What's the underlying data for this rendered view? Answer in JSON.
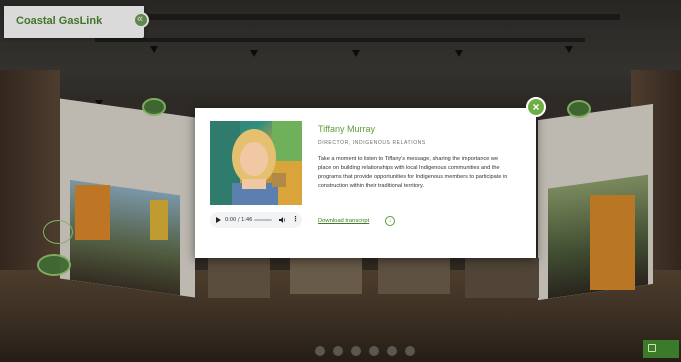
{
  "brand": {
    "name": "Coastal GasLink"
  },
  "modal": {
    "name": "Tiffany Murray",
    "role": "DIRECTOR, INDIGENOUS RELATIONS",
    "description": "Take a moment to listen to Tiffany's message, sharing the importance we place on building relationships with local Indigenous communities and the programs that provide opportunities for Indigenous members to participate in construction within their traditional territory.",
    "download_label": "Download transcript",
    "close_symbol": "×",
    "audio": {
      "time": "0:00 / 1:46"
    }
  },
  "colors": {
    "accent": "#5d9c3a",
    "brand": "#4a8a2e",
    "hotspot": "#4b7a3a"
  },
  "icons": {
    "brand_close": "collapse-icon",
    "modal_close": "close-icon",
    "download": "download-icon",
    "play": "play-icon",
    "volume": "volume-icon",
    "more": "more-vertical-icon"
  }
}
